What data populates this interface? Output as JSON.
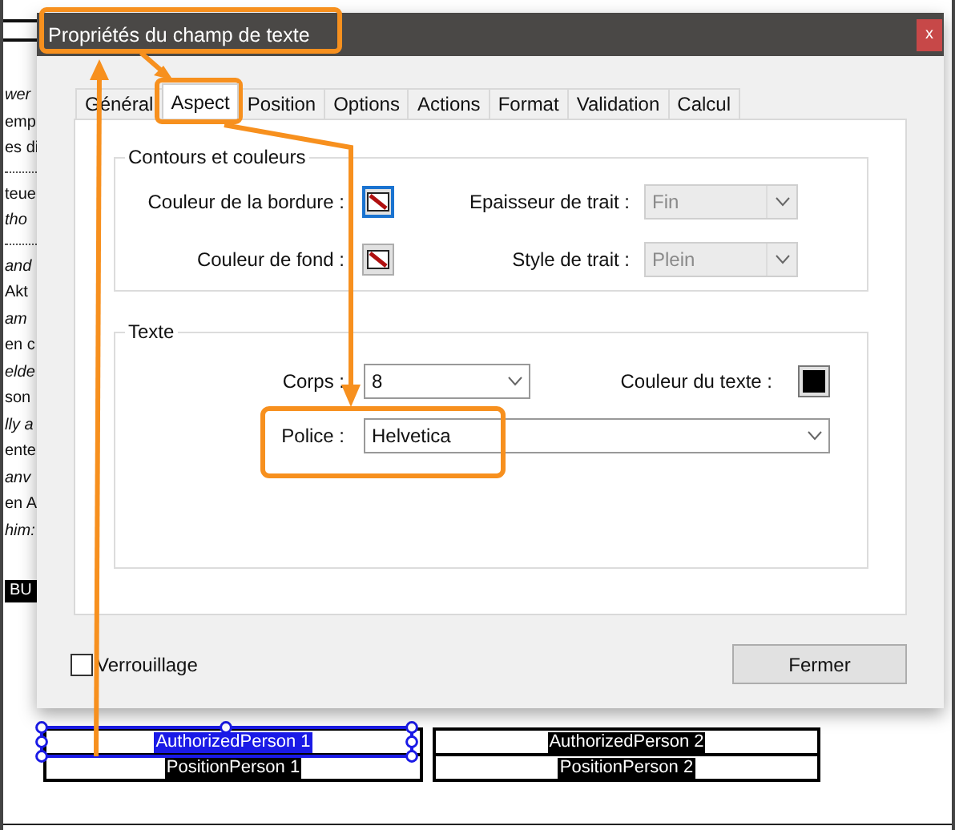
{
  "document": {
    "fragments": [
      {
        "text": "wer",
        "italic": true
      },
      {
        "text": "emp",
        "italic": false
      },
      {
        "text": "es di",
        "italic": false
      },
      {
        "text": "teue",
        "italic": false
      },
      {
        "text": "tho",
        "italic": true
      },
      {
        "text": "and",
        "italic": true
      },
      {
        "text": "Akt",
        "italic": false
      },
      {
        "text": "am",
        "italic": true
      },
      {
        "text": "en c",
        "italic": false
      },
      {
        "text": "elde",
        "italic": true
      },
      {
        "text": "son",
        "italic": false
      },
      {
        "text": "lly a",
        "italic": true
      },
      {
        "text": "ente",
        "italic": false
      },
      {
        "text": "anv",
        "italic": true
      },
      {
        "text": "en A",
        "italic": false
      },
      {
        "text": "him:",
        "italic": true
      }
    ],
    "badge": "BU",
    "field_tables": [
      {
        "rows": [
          {
            "label": "AuthorizedPerson 1",
            "selected": true
          },
          {
            "label": "PositionPerson 1",
            "selected": false
          }
        ]
      },
      {
        "rows": [
          {
            "label": "AuthorizedPerson 2",
            "selected": false
          },
          {
            "label": "PositionPerson 2",
            "selected": false
          }
        ]
      }
    ]
  },
  "dialog": {
    "title": "Propriétés du champ de texte",
    "close": "x",
    "tabs": [
      {
        "label": "Général",
        "selected": false
      },
      {
        "label": "Aspect",
        "selected": true
      },
      {
        "label": "Position",
        "selected": false
      },
      {
        "label": "Options",
        "selected": false
      },
      {
        "label": "Actions",
        "selected": false
      },
      {
        "label": "Format",
        "selected": false
      },
      {
        "label": "Validation",
        "selected": false
      },
      {
        "label": "Calcul",
        "selected": false
      }
    ],
    "borders_group": {
      "title": "Contours et couleurs",
      "border_color": {
        "label": "Couleur de la bordure :",
        "focused": true
      },
      "fill_color": {
        "label": "Couleur de fond :",
        "focused": false
      },
      "line_width": {
        "label": "Epaisseur de trait :",
        "value": "Fin",
        "disabled": true
      },
      "line_style": {
        "label": "Style de trait :",
        "value": "Plein",
        "disabled": true
      }
    },
    "text_group": {
      "title": "Texte",
      "font_size": {
        "label": "Corps :",
        "value": "8",
        "disabled": false
      },
      "text_color": {
        "label": "Couleur du texte :",
        "color": "#000000"
      },
      "font": {
        "label": "Police :",
        "value": "Helvetica",
        "disabled": false
      }
    },
    "lock": {
      "label": "Verrouillage",
      "checked": false
    },
    "close_button": "Fermer"
  }
}
